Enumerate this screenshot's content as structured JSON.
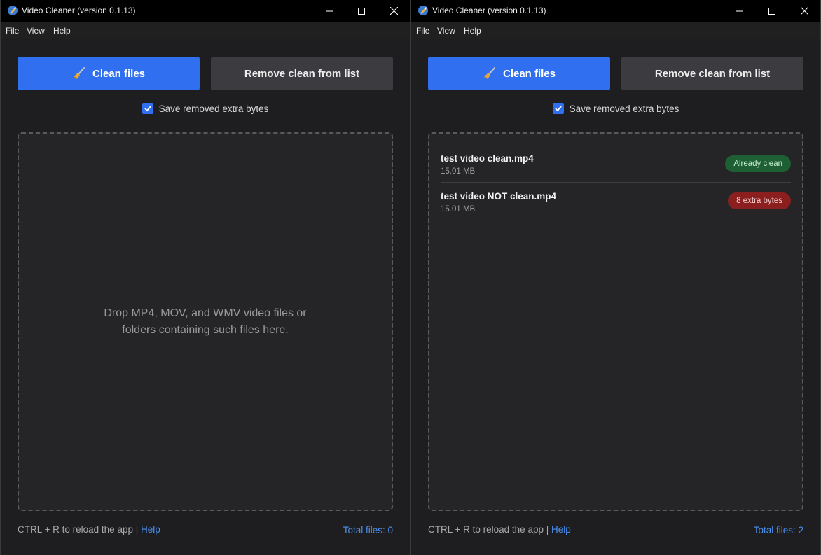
{
  "colors": {
    "accent": "#2f6ff0",
    "secondary_button": "#3c3c40",
    "link": "#4a90f0",
    "badge_clean": "#1e5f34",
    "badge_dirty": "#8b1f1f"
  },
  "windows": [
    {
      "title": "Video Cleaner (version 0.1.13)",
      "menu": {
        "file": "File",
        "view": "View",
        "help": "Help"
      },
      "clean_button": {
        "label": "Clean files",
        "icon": "broom-icon"
      },
      "remove_button": {
        "label": "Remove clean from list"
      },
      "save_checkbox": {
        "label": "Save removed extra bytes",
        "checked": true
      },
      "dropzone": {
        "text": "Drop MP4, MOV, and WMV video files or folders containing such files here."
      },
      "files": [],
      "footer": {
        "reload_text": "CTRL + R to reload the app |",
        "help_link": "Help",
        "total": "Total files: 0"
      }
    },
    {
      "title": "Video Cleaner (version 0.1.13)",
      "menu": {
        "file": "File",
        "view": "View",
        "help": "Help"
      },
      "clean_button": {
        "label": "Clean files",
        "icon": "broom-icon"
      },
      "remove_button": {
        "label": "Remove clean from list"
      },
      "save_checkbox": {
        "label": "Save removed extra bytes",
        "checked": true
      },
      "files": [
        {
          "name": "test video clean.mp4",
          "size": "15.01 MB",
          "status": "Already clean"
        },
        {
          "name": "test video NOT clean.mp4",
          "size": "15.01 MB",
          "status": "8 extra bytes"
        }
      ],
      "footer": {
        "reload_text": "CTRL + R to reload the app |",
        "help_link": "Help",
        "total": "Total files: 2"
      }
    }
  ]
}
